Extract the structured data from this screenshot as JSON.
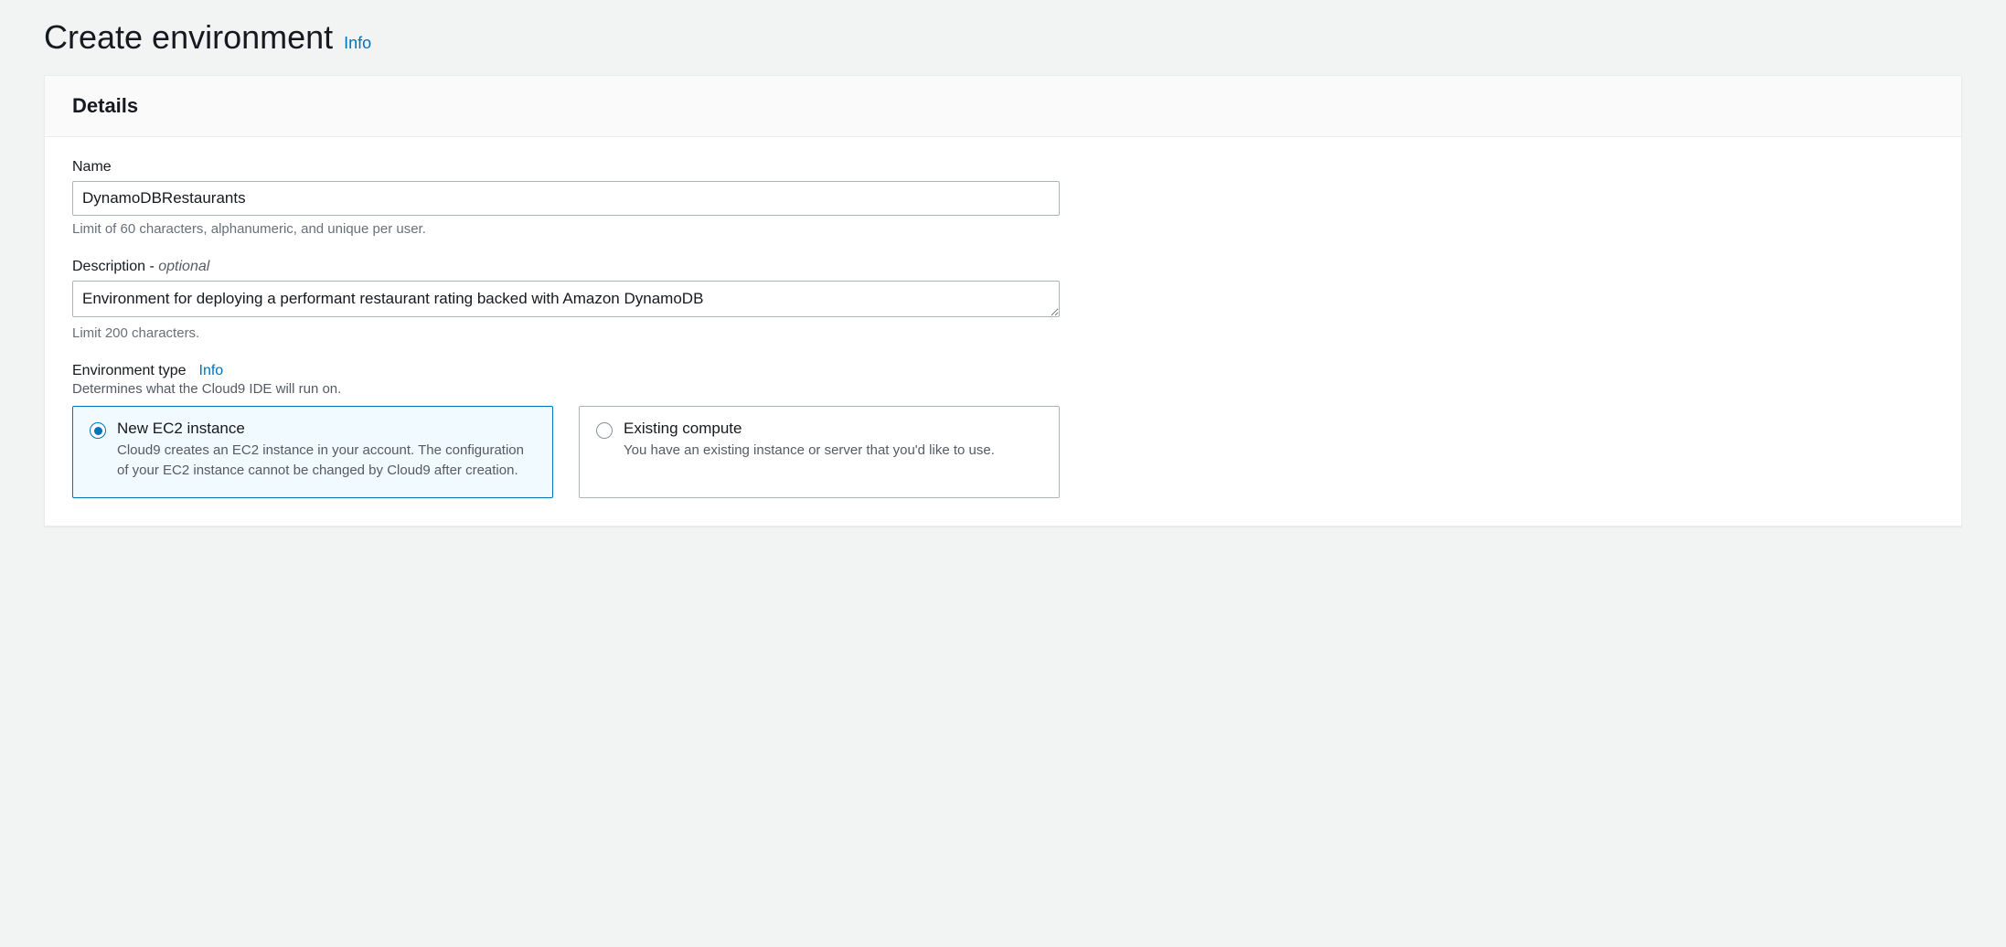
{
  "header": {
    "title": "Create environment",
    "info_link": "Info"
  },
  "panel": {
    "title": "Details"
  },
  "form": {
    "name": {
      "label": "Name",
      "value": "DynamoDBRestaurants",
      "hint": "Limit of 60 characters, alphanumeric, and unique per user."
    },
    "description": {
      "label": "Description - ",
      "optional_suffix": "optional",
      "value": "Environment for deploying a performant restaurant rating backed with Amazon DynamoDB",
      "hint": "Limit 200 characters."
    },
    "env_type": {
      "label": "Environment type",
      "info_link": "Info",
      "sublabel": "Determines what the Cloud9 IDE will run on.",
      "options": [
        {
          "title": "New EC2 instance",
          "desc": "Cloud9 creates an EC2 instance in your account. The configuration of your EC2 instance cannot be changed by Cloud9 after creation.",
          "selected": true
        },
        {
          "title": "Existing compute",
          "desc": "You have an existing instance or server that you'd like to use.",
          "selected": false
        }
      ]
    }
  }
}
